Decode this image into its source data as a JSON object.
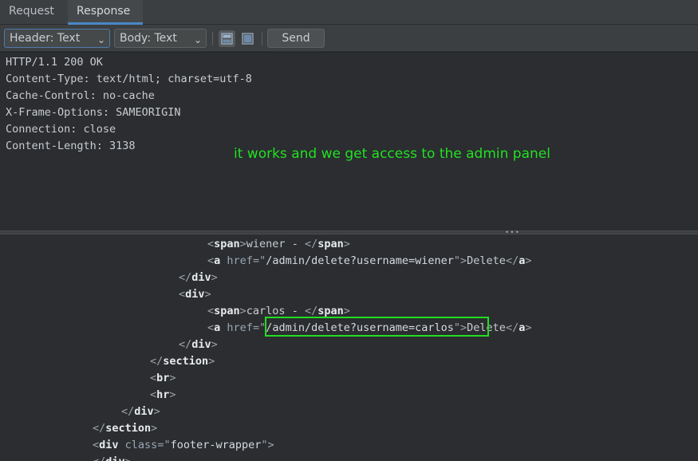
{
  "tabs": [
    {
      "label": "Request"
    },
    {
      "label": "Response"
    }
  ],
  "toolbar": {
    "header_select": "Header: Text",
    "body_select": "Body: Text",
    "send_label": "Send"
  },
  "response_headers": [
    "HTTP/1.1 200 OK",
    "Content-Type: text/html; charset=utf-8",
    "Cache-Control: no-cache",
    "X-Frame-Options: SAMEORIGIN",
    "Connection: close",
    "Content-Length: 3138"
  ],
  "annotation": "it works and we get access to the admin panel",
  "body_code": {
    "span1_tag": "span",
    "span1_text": "wiener - ",
    "a_tag": "a",
    "href_attr": "href",
    "href_wiener": "/admin/delete?username=wiener",
    "delete_label": "Delete",
    "div_tag": "div",
    "span2_text": "carlos - ",
    "href_carlos": "/admin/delete?username=carlos",
    "section_tag": "section",
    "br_tag": "br",
    "hr_tag": "hr",
    "class_attr": "class",
    "footer_class": "footer-wrapper"
  },
  "colors": {
    "annotation": "#22e022",
    "highlight_border": "#22dd22",
    "tab_accent": "#4a88c7"
  }
}
